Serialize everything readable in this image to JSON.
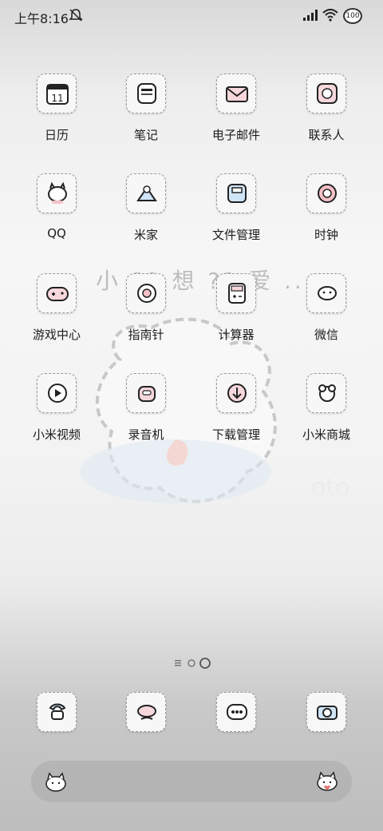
{
  "status": {
    "time": "上午8:16",
    "battery": "100"
  },
  "watermark": "小 ?? 想 ?? 爱 ..",
  "apps": [
    {
      "label": "日历",
      "icon": "calendar-icon"
    },
    {
      "label": "笔记",
      "icon": "notes-icon"
    },
    {
      "label": "电子邮件",
      "icon": "mail-icon"
    },
    {
      "label": "联系人",
      "icon": "contacts-icon"
    },
    {
      "label": "QQ",
      "icon": "qq-icon"
    },
    {
      "label": "米家",
      "icon": "mijia-icon"
    },
    {
      "label": "文件管理",
      "icon": "files-icon"
    },
    {
      "label": "时钟",
      "icon": "clock-icon"
    },
    {
      "label": "游戏中心",
      "icon": "game-icon"
    },
    {
      "label": "指南针",
      "icon": "compass-icon"
    },
    {
      "label": "计算器",
      "icon": "calculator-icon"
    },
    {
      "label": "微信",
      "icon": "wechat-icon"
    },
    {
      "label": "小米视频",
      "icon": "video-icon"
    },
    {
      "label": "录音机",
      "icon": "recorder-icon"
    },
    {
      "label": "下载管理",
      "icon": "download-icon"
    },
    {
      "label": "小米商城",
      "icon": "mall-icon"
    }
  ],
  "dock": [
    {
      "icon": "phone-icon"
    },
    {
      "icon": "messages-icon"
    },
    {
      "icon": "browser-icon"
    },
    {
      "icon": "camera-icon"
    }
  ]
}
